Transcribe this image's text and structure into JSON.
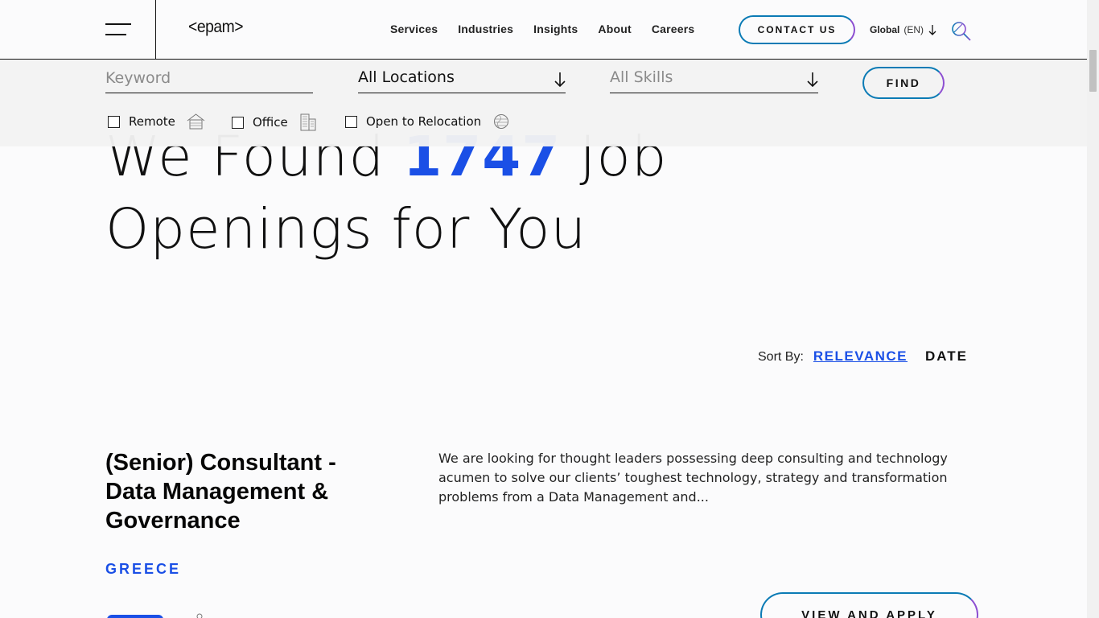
{
  "header": {
    "logo": "<epam>",
    "nav": [
      "Services",
      "Industries",
      "Insights",
      "About",
      "Careers"
    ],
    "contact_label": "CONTACT US",
    "lang_region": "Global",
    "lang_code": "(EN)"
  },
  "filters": {
    "keyword_placeholder": "Keyword",
    "location_value": "All Locations",
    "skills_value": "All Skills",
    "find_label": "FIND",
    "checkboxes": [
      {
        "label": "Remote",
        "checked": false,
        "icon": "house-icon"
      },
      {
        "label": "Office",
        "checked": false,
        "icon": "building-icon"
      },
      {
        "label": "Open to Relocation",
        "checked": false,
        "icon": "globe-icon"
      }
    ]
  },
  "hero": {
    "prefix": "We Found",
    "count": "1747",
    "suffix_line1": "Job",
    "line2": "Openings for You"
  },
  "sort": {
    "label": "Sort By:",
    "relevance": "RELEVANCE",
    "date": "DATE"
  },
  "job": {
    "title": "(Senior) Consultant - Data Management & Governance",
    "description": "We are looking for thought leaders possessing deep consulting and technology acumen to solve our clients’ toughest technology, strategy and transformation problems from a Data Management and...",
    "location": "GREECE",
    "apply_label": "VIEW AND APPLY"
  },
  "colors": {
    "accent_blue": "#1a4fe6",
    "button_gradient_start": "#0b7bb5",
    "button_gradient_end": "#8d4fd1"
  }
}
